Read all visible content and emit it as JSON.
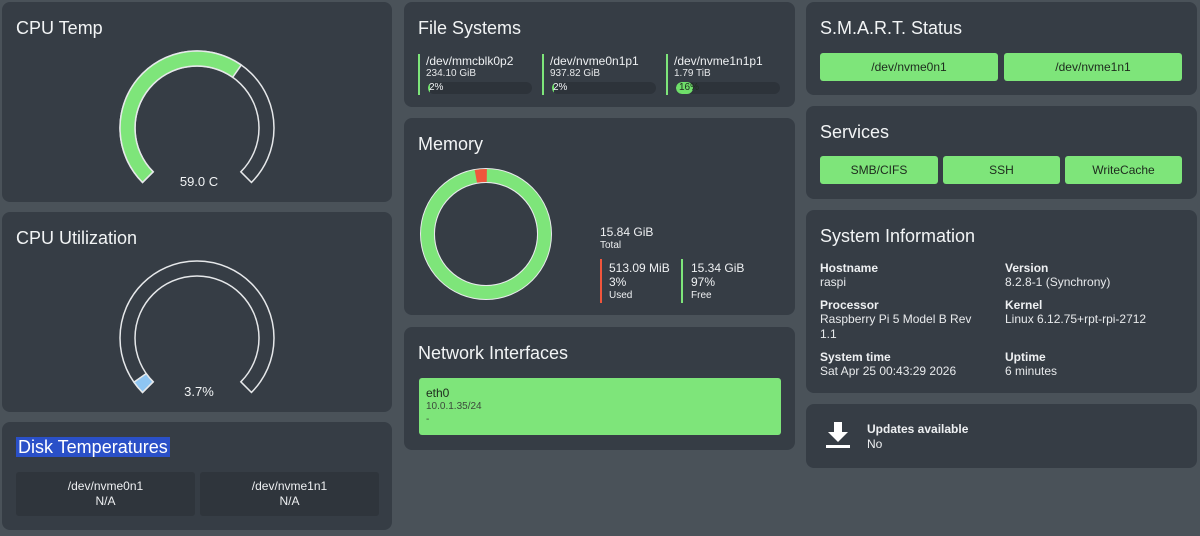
{
  "cpu_temp": {
    "title": "CPU Temp",
    "value_label": "59.0 C",
    "fraction": 0.63,
    "color": "#7ee57a"
  },
  "cpu_util": {
    "title": "CPU Utilization",
    "value_label": "3.7%",
    "fraction": 0.037,
    "color": "#8ec5f2"
  },
  "disk_temps": {
    "title": "Disk Temperatures",
    "disks": [
      {
        "name": "/dev/nvme0n1",
        "value": "N/A"
      },
      {
        "name": "/dev/nvme1n1",
        "value": "N/A"
      }
    ]
  },
  "file_systems": {
    "title": "File Systems",
    "items": [
      {
        "name": "/dev/mmcblk0p2",
        "size": "234.10 GiB",
        "percent_label": "2%",
        "fraction": 0.02
      },
      {
        "name": "/dev/nvme0n1p1",
        "size": "937.82 GiB",
        "percent_label": "2%",
        "fraction": 0.02
      },
      {
        "name": "/dev/nvme1n1p1",
        "size": "1.79 TiB",
        "percent_label": "16%",
        "fraction": 0.16
      }
    ]
  },
  "memory": {
    "title": "Memory",
    "total_value": "15.84 GiB",
    "total_label": "Total",
    "used_value": "513.09 MiB",
    "used_percent": "3%",
    "used_label": "Used",
    "free_value": "15.34 GiB",
    "free_percent": "97%",
    "free_label": "Free",
    "used_fraction": 0.03,
    "used_color": "#f0553c",
    "free_color": "#7ee57a"
  },
  "network": {
    "title": "Network Interfaces",
    "interfaces": [
      {
        "name": "eth0",
        "address": "10.0.1.35/24",
        "extra": "-"
      }
    ]
  },
  "smart": {
    "title": "S.M.A.R.T. Status",
    "devices": [
      "/dev/nvme0n1",
      "/dev/nvme1n1"
    ]
  },
  "services": {
    "title": "Services",
    "items": [
      "SMB/CIFS",
      "SSH",
      "WriteCache"
    ]
  },
  "system_info": {
    "title": "System Information",
    "hostname_label": "Hostname",
    "hostname": "raspi",
    "version_label": "Version",
    "version": "8.2.8-1 (Synchrony)",
    "processor_label": "Processor",
    "processor_line1": "Raspberry Pi 5 Model B Rev",
    "processor_line2": "1.1",
    "kernel_label": "Kernel",
    "kernel": "Linux 6.12.75+rpt-rpi-2712",
    "time_label": "System time",
    "time": "Sat Apr 25 00:43:29 2026",
    "uptime_label": "Uptime",
    "uptime": "6 minutes"
  },
  "updates": {
    "title": "Updates available",
    "value": "No",
    "icon": "download-icon"
  }
}
